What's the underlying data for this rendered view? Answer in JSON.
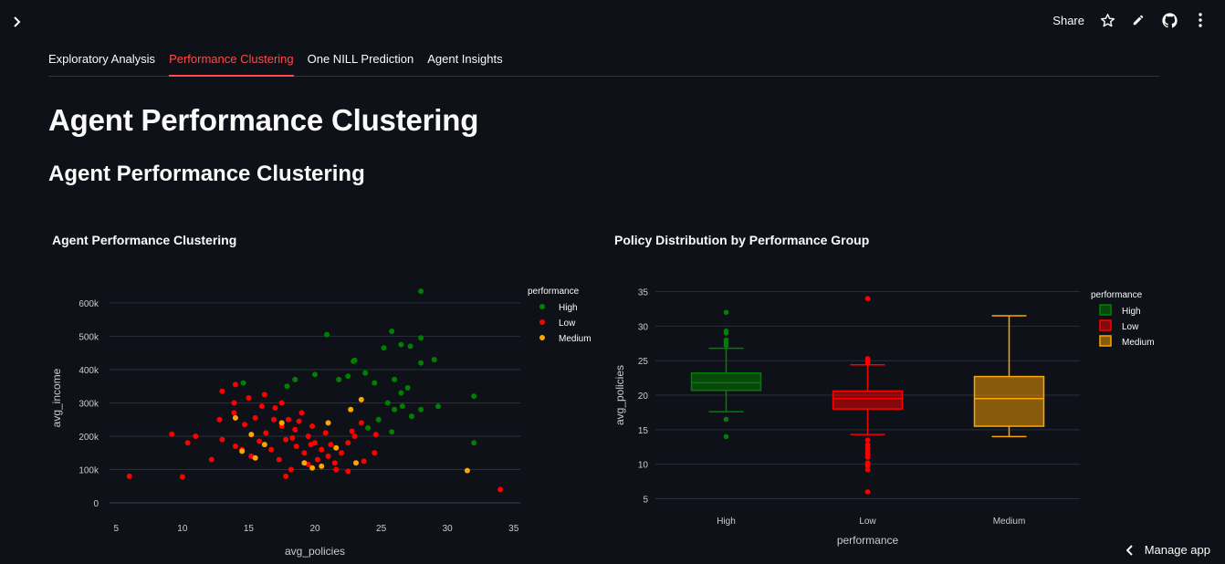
{
  "header": {
    "share_label": "Share",
    "icons": [
      "star-icon",
      "edit-icon",
      "github-icon",
      "more-icon"
    ]
  },
  "tabs": [
    {
      "label": "Exploratory Analysis",
      "active": false
    },
    {
      "label": "Performance Clustering",
      "active": true
    },
    {
      "label": "One NILL Prediction",
      "active": false
    },
    {
      "label": "Agent Insights",
      "active": false
    }
  ],
  "page": {
    "title": "Agent Performance Clustering",
    "subtitle": "Agent Performance Clustering"
  },
  "footer": {
    "manage_label": "Manage app"
  },
  "colors": {
    "background": "#0e1117",
    "accent": "#ff4b4b",
    "high": "#008000",
    "low": "#ff0000",
    "medium": "#ffa500"
  },
  "chart_data": [
    {
      "type": "scatter",
      "title": "Agent Performance Clustering",
      "xlabel": "avg_policies",
      "ylabel": "avg_income",
      "xlim": [
        4.5,
        35.5
      ],
      "ylim": [
        -30000,
        660000
      ],
      "xticks": [
        5,
        10,
        15,
        20,
        25,
        30,
        35
      ],
      "yticks": [
        0,
        100000,
        200000,
        300000,
        400000,
        500000,
        600000
      ],
      "ytick_labels": [
        "0",
        "100k",
        "200k",
        "300k",
        "400k",
        "500k",
        "600k"
      ],
      "grid": "horizontal",
      "legend_title": "performance",
      "legend_position": "top-right",
      "series": [
        {
          "name": "High",
          "color": "#008000",
          "points": [
            [
              28,
              635000
            ],
            [
              25.8,
              515000
            ],
            [
              28,
              495000
            ],
            [
              26.5,
              475000
            ],
            [
              25.2,
              465000
            ],
            [
              20.9,
              505000
            ],
            [
              27.2,
              470000
            ],
            [
              29,
              430000
            ],
            [
              28,
              420000
            ],
            [
              22.9,
              425000
            ],
            [
              23,
              428000
            ],
            [
              32,
              320000
            ],
            [
              29.3,
              290000
            ],
            [
              28,
              280000
            ],
            [
              32,
              180000
            ],
            [
              26,
              370000
            ],
            [
              27,
              345000
            ],
            [
              26.5,
              330000
            ],
            [
              24.5,
              360000
            ],
            [
              23.8,
              390000
            ],
            [
              22.5,
              380000
            ],
            [
              21.8,
              370000
            ],
            [
              25.5,
              300000
            ],
            [
              26,
              280000
            ],
            [
              27.3,
              260000
            ],
            [
              24.8,
              250000
            ],
            [
              20,
              385000
            ],
            [
              18.5,
              370000
            ],
            [
              17.9,
              350000
            ],
            [
              14.6,
              360000
            ],
            [
              26.6,
              290000
            ],
            [
              24,
              225000
            ],
            [
              25.8,
              213000
            ]
          ]
        },
        {
          "name": "Low",
          "color": "#ff0000",
          "points": [
            [
              34,
              40000
            ],
            [
              6,
              80000
            ],
            [
              10,
              78000
            ],
            [
              9.2,
              206000
            ],
            [
              10.4,
              180000
            ],
            [
              11,
              200000
            ],
            [
              13,
              335000
            ],
            [
              14,
              355000
            ],
            [
              13.9,
              300000
            ],
            [
              15,
              315000
            ],
            [
              16,
              290000
            ],
            [
              16.2,
              325000
            ],
            [
              17,
              285000
            ],
            [
              17.5,
              300000
            ],
            [
              12.2,
              130000
            ],
            [
              13,
              190000
            ],
            [
              12.8,
              250000
            ],
            [
              14,
              170000
            ],
            [
              15.2,
              140000
            ],
            [
              14.5,
              160000
            ],
            [
              17.8,
              80000
            ],
            [
              18.2,
              100000
            ],
            [
              17.3,
              130000
            ],
            [
              16.7,
              160000
            ],
            [
              15.8,
              185000
            ],
            [
              16.3,
              210000
            ],
            [
              17.5,
              230000
            ],
            [
              18,
              250000
            ],
            [
              19,
              270000
            ],
            [
              18.5,
              220000
            ],
            [
              19.5,
              200000
            ],
            [
              20,
              180000
            ],
            [
              20.5,
              160000
            ],
            [
              21,
              140000
            ],
            [
              21.5,
              120000
            ],
            [
              22,
              150000
            ],
            [
              22.5,
              180000
            ],
            [
              23,
              200000
            ],
            [
              20.8,
              210000
            ],
            [
              19.8,
              230000
            ],
            [
              18.8,
              245000
            ],
            [
              17.8,
              190000
            ],
            [
              18.6,
              170000
            ],
            [
              19.2,
              150000
            ],
            [
              20.2,
              130000
            ],
            [
              21.6,
              100000
            ],
            [
              22.5,
              95000
            ],
            [
              23.7,
              125000
            ],
            [
              24.5,
              150000
            ],
            [
              24.6,
              205000
            ],
            [
              13.9,
              270000
            ],
            [
              14.7,
              235000
            ],
            [
              15.5,
              255000
            ],
            [
              16.9,
              250000
            ],
            [
              18.3,
              195000
            ],
            [
              19.7,
              175000
            ],
            [
              21.2,
              175000
            ],
            [
              22.8,
              215000
            ],
            [
              23.5,
              240000
            ],
            [
              19.5,
              115000
            ]
          ]
        },
        {
          "name": "Medium",
          "color": "#ffa500",
          "points": [
            [
              31.5,
              97000
            ],
            [
              14,
              255000
            ],
            [
              15.2,
              205000
            ],
            [
              15.5,
              135000
            ],
            [
              21,
              240000
            ],
            [
              22.7,
              280000
            ],
            [
              23.5,
              310000
            ],
            [
              19.8,
              105000
            ],
            [
              20.5,
              110000
            ],
            [
              23.1,
              120000
            ],
            [
              19.2,
              120000
            ],
            [
              17.5,
              240000
            ],
            [
              16.2,
              175000
            ],
            [
              21.6,
              165000
            ],
            [
              14.5,
              155000
            ]
          ]
        }
      ]
    },
    {
      "type": "box",
      "title": "Policy Distribution by Performance Group",
      "xlabel": "performance",
      "ylabel": "avg_policies",
      "categories": [
        "High",
        "Low",
        "Medium"
      ],
      "ylim": [
        4,
        36
      ],
      "yticks": [
        5,
        10,
        15,
        20,
        25,
        30,
        35
      ],
      "grid": "horizontal",
      "legend_title": "performance",
      "legend_position": "top-right",
      "boxes": [
        {
          "name": "High",
          "color": "#008000",
          "min": 17.6,
          "q1": 20.7,
          "median": 21.8,
          "q3": 23.2,
          "max": 26.8,
          "outliers": [
            32,
            29.3,
            29,
            28,
            27.6,
            27.2,
            16.5,
            14
          ]
        },
        {
          "name": "Low",
          "color": "#ff0000",
          "min": 14.3,
          "q1": 18,
          "median": 19.5,
          "q3": 20.6,
          "max": 24.4,
          "outliers": [
            34,
            25.3,
            25,
            24.7,
            13.5,
            12.8,
            12.4,
            11.9,
            11.5,
            11,
            10.2,
            9.8,
            9.2,
            6
          ]
        },
        {
          "name": "Medium",
          "color": "#ffa500",
          "min": 14,
          "q1": 15.5,
          "median": 19.5,
          "q3": 22.7,
          "max": 31.5,
          "outliers": []
        }
      ]
    }
  ]
}
